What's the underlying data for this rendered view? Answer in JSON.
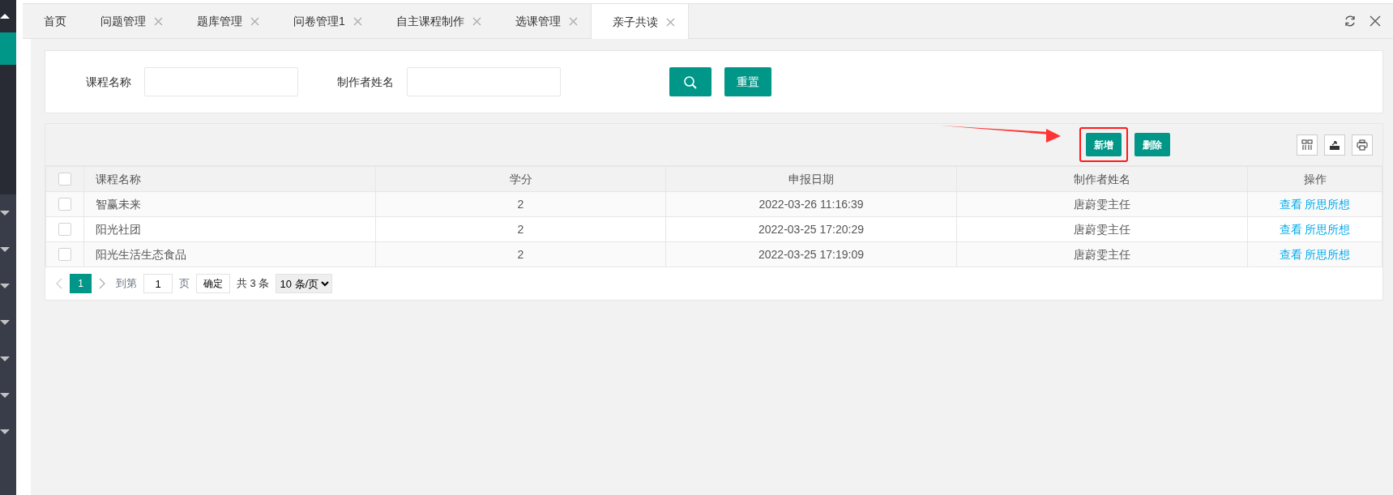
{
  "sidebar": {
    "items": [
      {
        "expanded": true,
        "children": [
          {
            "selected": true
          },
          {
            "selected": false
          },
          {
            "selected": false
          },
          {
            "selected": false
          },
          {
            "selected": false
          }
        ]
      },
      {
        "expanded": false
      },
      {
        "expanded": false
      },
      {
        "expanded": false
      },
      {
        "expanded": false
      },
      {
        "expanded": false
      },
      {
        "expanded": false
      },
      {
        "expanded": false
      }
    ]
  },
  "tabs": [
    {
      "label": "首页",
      "selected": false,
      "closable": false
    },
    {
      "label": "问题管理",
      "selected": false,
      "closable": true
    },
    {
      "label": "题库管理",
      "selected": false,
      "closable": true
    },
    {
      "label": "问卷管理1",
      "selected": false,
      "closable": true
    },
    {
      "label": "自主课程制作",
      "selected": false,
      "closable": true
    },
    {
      "label": "选课管理",
      "selected": false,
      "closable": true
    },
    {
      "label": "亲子共读",
      "selected": true,
      "closable": true
    }
  ],
  "search": {
    "fields": [
      {
        "label": "课程名称"
      },
      {
        "label": "制作者姓名"
      }
    ],
    "reset_button": "重置"
  },
  "toolbar": {
    "buttons": [
      {
        "label": "新增",
        "highlighted": true
      },
      {
        "label": "删除",
        "highlighted": false
      }
    ]
  },
  "table": {
    "all_checked": false,
    "columns": [
      {
        "label": "课程名称"
      },
      {
        "label": "学分"
      },
      {
        "label": "申报日期"
      },
      {
        "label": "制作者姓名"
      },
      {
        "label": "操作"
      }
    ],
    "rows": [
      {
        "checked": false,
        "cells": [
          "智赢未来",
          "2",
          "2022-03-26 11:16:39",
          "唐蔚雯主任"
        ],
        "actions": [
          "查看",
          "所思所想"
        ]
      },
      {
        "checked": false,
        "cells": [
          "阳光社团",
          "2",
          "2022-03-25 17:20:29",
          "唐蔚雯主任"
        ],
        "actions": [
          "查看",
          "所思所想"
        ]
      },
      {
        "checked": false,
        "cells": [
          "阳光生活生态食品",
          "2",
          "2022-03-25 17:19:09",
          "唐蔚雯主任"
        ],
        "actions": [
          "查看",
          "所思所想"
        ]
      }
    ]
  },
  "pagination": {
    "pages": [
      {
        "label": "1",
        "selected": true
      }
    ],
    "goto_label": "到第",
    "goto_value": "1",
    "page_label": "页",
    "confirm": "确定",
    "total": "共 3 条",
    "page_size": "10 条/页"
  }
}
